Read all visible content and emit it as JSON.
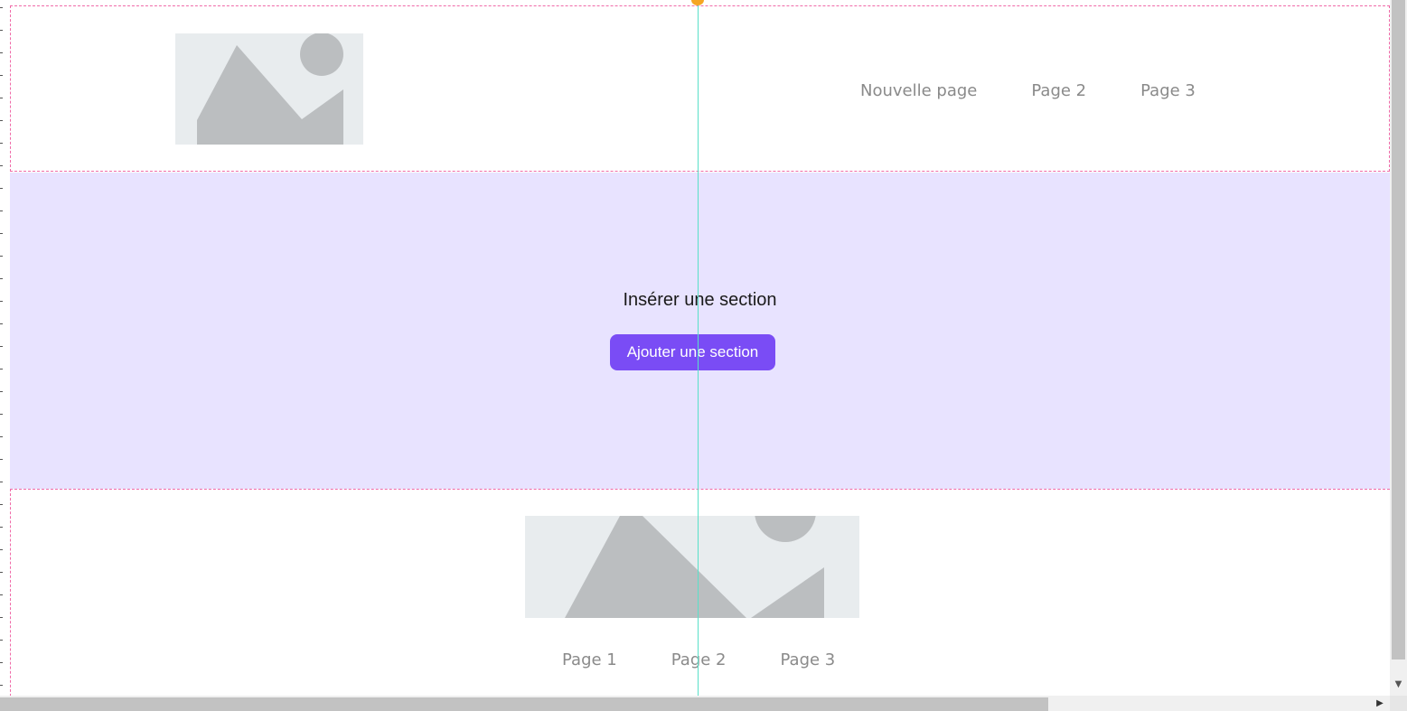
{
  "header": {
    "nav_items": [
      "Nouvelle page",
      "Page 2",
      "Page 3"
    ]
  },
  "insert_section": {
    "title": "Insérer une section",
    "button_label": "Ajouter une section"
  },
  "footer": {
    "nav_items": [
      "Page 1",
      "Page 2",
      "Page 3"
    ]
  },
  "colors": {
    "section_outline": "#f06aa8",
    "insert_zone_bg": "#e8e3ff",
    "accent": "#7a4cf5",
    "guide_line": "#59e0c9",
    "guide_handle": "#f5a623",
    "nav_text": "#8a8a8a",
    "image_placeholder_bg": "#e8ecee",
    "image_placeholder_shape": "#bbbec0"
  },
  "icons": {
    "header_logo": "image-placeholder-icon",
    "footer_image": "image-placeholder-icon",
    "guide_handle": "guide-handle-icon",
    "scroll_down": "chevron-down-icon",
    "scroll_right": "chevron-right-icon"
  }
}
